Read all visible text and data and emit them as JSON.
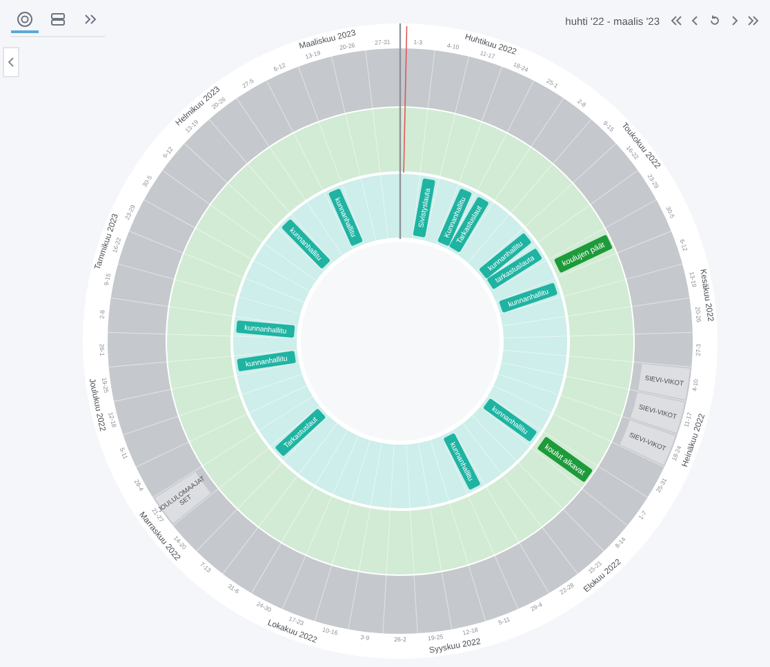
{
  "toolbar": {
    "views": [
      {
        "kind": "wheel",
        "selected": true
      },
      {
        "kind": "rows",
        "selected": false
      }
    ]
  },
  "period": "huhti '22 - maalis '23",
  "months": [
    {
      "name": "Huhtikuu 2022",
      "weeks": [
        {
          "label": "1-3"
        },
        {
          "label": "4-10",
          "events": [
            {
              "kind": "meeting",
              "label": "Sivistyslauta"
            }
          ]
        },
        {
          "label": "11-17"
        },
        {
          "label": "18-24",
          "events": [
            {
              "kind": "meeting",
              "label": "Kunnanhallitu"
            }
          ]
        },
        {
          "label": "25-1",
          "events": [
            {
              "kind": "meeting",
              "label": "Tarkastuslaut"
            }
          ]
        }
      ]
    },
    {
      "name": "Toukokuu 2022",
      "weeks": [
        {
          "label": "2-8"
        },
        {
          "label": "9-15"
        },
        {
          "label": "16-22",
          "events": [
            {
              "kind": "meeting",
              "label": "kunnanhallitu"
            }
          ]
        },
        {
          "label": "23-29",
          "events": [
            {
              "kind": "meeting",
              "label": "tarkastuslauta"
            }
          ]
        },
        {
          "label": "30-5",
          "events": [
            {
              "kind": "school",
              "label": "koulujen päät"
            }
          ]
        }
      ]
    },
    {
      "name": "Kesäkuu 2022",
      "weeks": [
        {
          "label": "6-12",
          "events": [
            {
              "kind": "meeting",
              "label": "kunnanhallitu"
            }
          ]
        },
        {
          "label": "13-19"
        },
        {
          "label": "20-26"
        },
        {
          "label": "27-3"
        }
      ]
    },
    {
      "name": "Heinäkuu 2022",
      "weeks": [
        {
          "label": "4-10",
          "events": [
            {
              "kind": "holiday",
              "label": "SIEVI-VIKOT"
            }
          ]
        },
        {
          "label": "11-17",
          "events": [
            {
              "kind": "holiday",
              "label": "SIEVI-VIKOT"
            }
          ]
        },
        {
          "label": "18-24",
          "events": [
            {
              "kind": "holiday",
              "label": "SIEVI-VIKOT"
            }
          ]
        },
        {
          "label": "25-31"
        }
      ]
    },
    {
      "name": "Elokuu 2022",
      "weeks": [
        {
          "label": "1-7",
          "events": [
            {
              "kind": "meeting",
              "label": "kunnanhallitu"
            },
            {
              "kind": "school",
              "label": "koulut alkavat"
            }
          ]
        },
        {
          "label": "8-14"
        },
        {
          "label": "15-21"
        },
        {
          "label": "22-28"
        },
        {
          "label": "29-4",
          "events": [
            {
              "kind": "meeting",
              "label": "kunnanhallitu"
            }
          ]
        }
      ]
    },
    {
      "name": "Syyskuu 2022",
      "weeks": [
        {
          "label": "5-11"
        },
        {
          "label": "12-18"
        },
        {
          "label": "19-25"
        },
        {
          "label": "26-2"
        }
      ]
    },
    {
      "name": "Lokakuu 2022",
      "weeks": [
        {
          "label": "3-9"
        },
        {
          "label": "10-16"
        },
        {
          "label": "17-23"
        },
        {
          "label": "24-30"
        },
        {
          "label": "31-6"
        }
      ]
    },
    {
      "name": "Marraskuu 2022",
      "weeks": [
        {
          "label": "7-13"
        },
        {
          "label": "14-20",
          "events": [
            {
              "kind": "meeting",
              "label": "Tarkastuslaut"
            }
          ]
        },
        {
          "label": "21-27",
          "events": [
            {
              "kind": "holiday",
              "label": "JOULULOMAAJAT SET"
            }
          ]
        },
        {
          "label": "28-4"
        }
      ]
    },
    {
      "name": "Joulukuu 2022",
      "weeks": [
        {
          "label": "5-11"
        },
        {
          "label": "12-18"
        },
        {
          "label": "19-25",
          "events": [
            {
              "kind": "meeting",
              "label": "kunnanhallitu"
            }
          ]
        },
        {
          "label": "26-1"
        }
      ]
    },
    {
      "name": "Tammikuu 2023",
      "weeks": [
        {
          "label": "2-8",
          "events": [
            {
              "kind": "meeting",
              "label": "kunnanhallitu"
            }
          ]
        },
        {
          "label": "9-15"
        },
        {
          "label": "16-22"
        },
        {
          "label": "23-29"
        },
        {
          "label": "30-5"
        }
      ]
    },
    {
      "name": "Helmikuu 2023",
      "weeks": [
        {
          "label": "6-12"
        },
        {
          "label": "13-19",
          "events": [
            {
              "kind": "meeting",
              "label": "kunnanhallitu"
            }
          ]
        },
        {
          "label": "20-26"
        },
        {
          "label": "27-5"
        }
      ]
    },
    {
      "name": "Maaliskuu 2023",
      "weeks": [
        {
          "label": "6-12",
          "events": [
            {
              "kind": "meeting",
              "label": "kunnanhallitu"
            }
          ]
        },
        {
          "label": "13-19"
        },
        {
          "label": "20-26"
        },
        {
          "label": "27-31"
        }
      ]
    }
  ]
}
